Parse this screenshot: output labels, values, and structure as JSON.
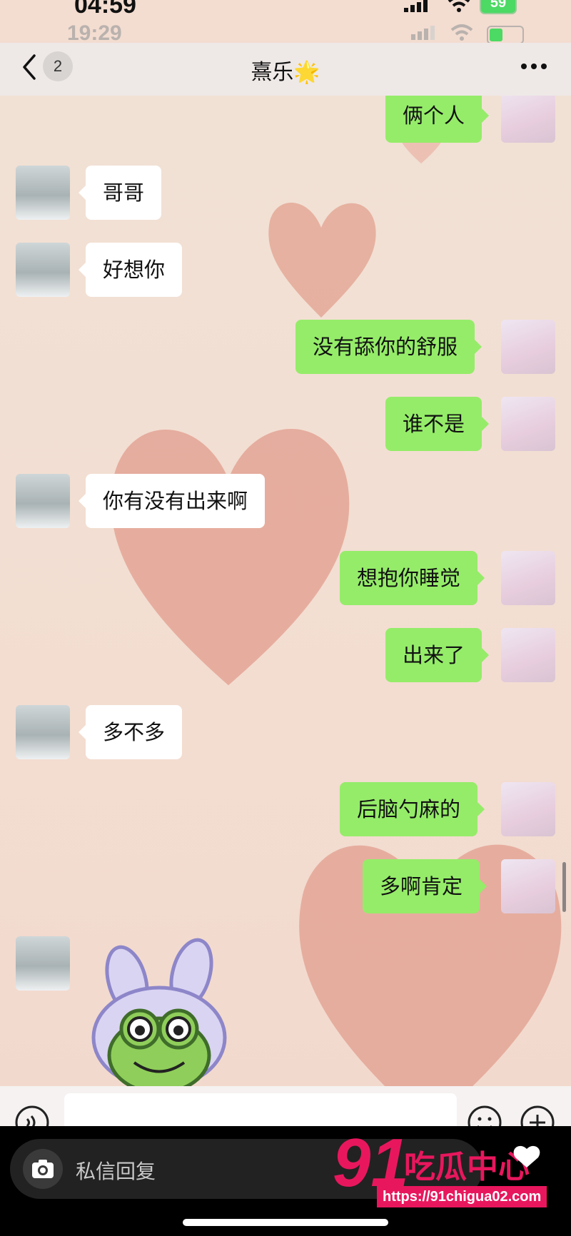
{
  "status_bar": {
    "outer_time": "04:59",
    "inner_time": "19:29",
    "outer_battery": "59"
  },
  "header": {
    "unread_count": "2",
    "title": "熹乐",
    "title_emoji": "🌟"
  },
  "messages": [
    {
      "side": "right",
      "text": "俩个人"
    },
    {
      "side": "left",
      "text": "哥哥"
    },
    {
      "side": "left",
      "text": "好想你"
    },
    {
      "side": "right",
      "text": "没有舔你的舒服"
    },
    {
      "side": "right",
      "text": "谁不是"
    },
    {
      "side": "left",
      "text": "你有没有出来啊"
    },
    {
      "side": "right",
      "text": "想抱你睡觉"
    },
    {
      "side": "right",
      "text": "出来了"
    },
    {
      "side": "left",
      "text": "多不多"
    },
    {
      "side": "right",
      "text": "后脑勺麻的"
    },
    {
      "side": "right",
      "text": "多啊肯定"
    },
    {
      "side": "left",
      "type": "sticker",
      "sticker": "frog-bunny-sticker"
    }
  ],
  "input_bar": {
    "text": ""
  },
  "bottom_overlay": {
    "reply_placeholder": "私信回复",
    "watermark_logo": "91吃瓜中心",
    "watermark_url": "https://91chigua02.com"
  },
  "colors": {
    "bubble_right": "#95ec69",
    "bubble_left": "#ffffff",
    "watermark_pink": "#e8175d",
    "heart": "#e3a595"
  }
}
